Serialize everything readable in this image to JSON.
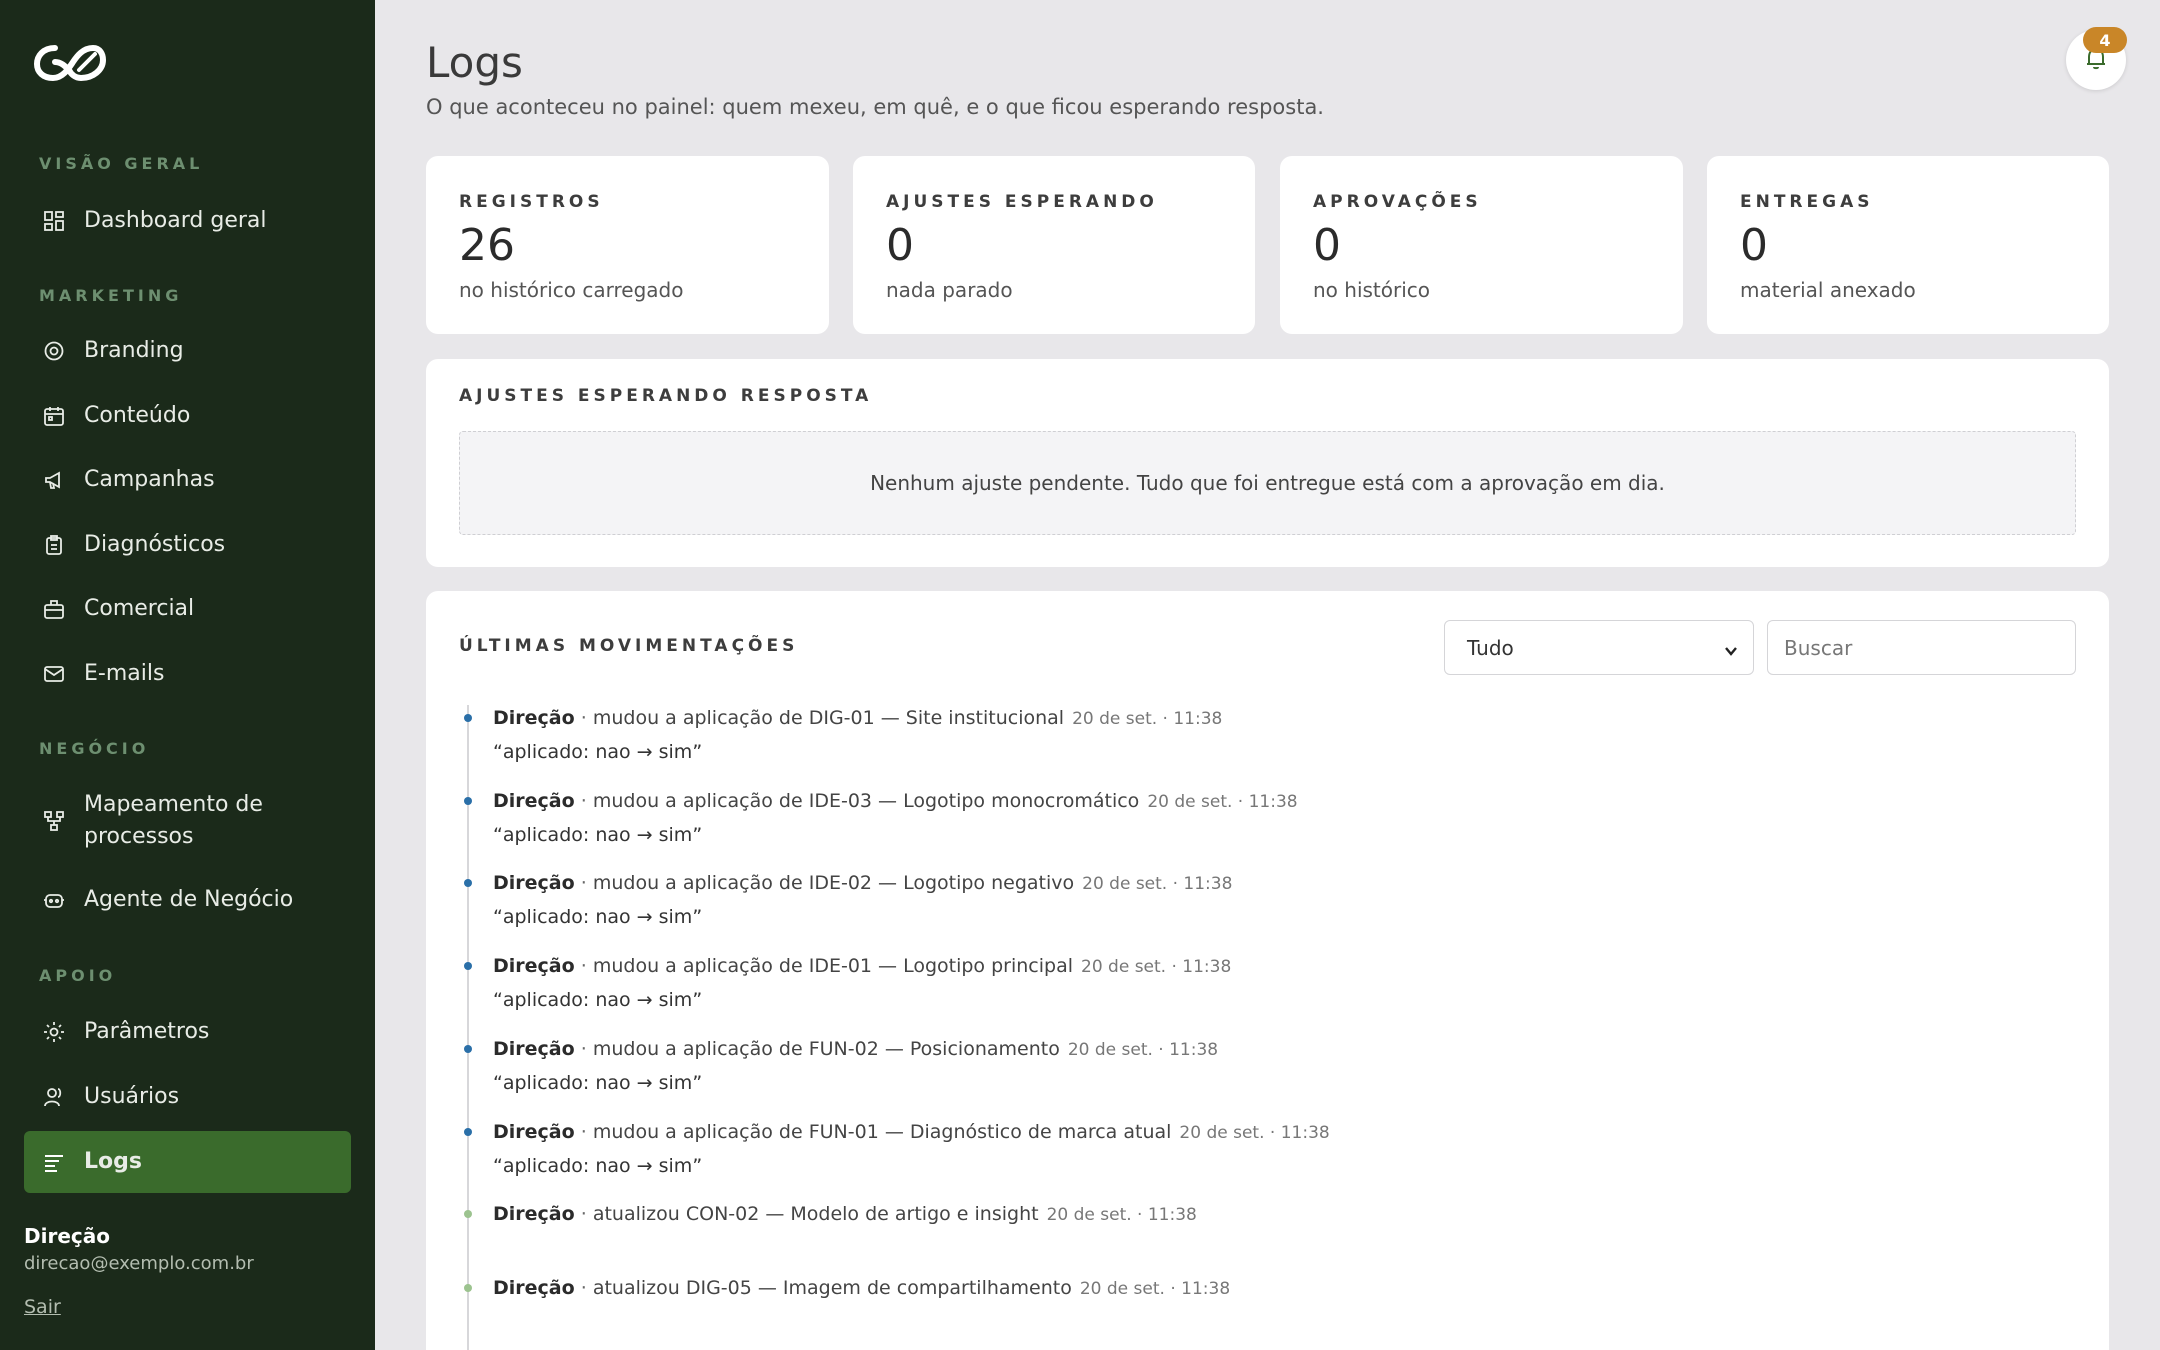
{
  "sidebar": {
    "sections": {
      "overview": "VISÃO GERAL",
      "marketing": "MARKETING",
      "business": "NEGÓCIO",
      "support": "APOIO"
    },
    "items": [
      {
        "label": "Dashboard geral",
        "icon": "dashboard-icon"
      },
      {
        "label": "Branding",
        "icon": "target-icon"
      },
      {
        "label": "Conteúdo",
        "icon": "calendar-icon"
      },
      {
        "label": "Campanhas",
        "icon": "megaphone-icon"
      },
      {
        "label": "Diagnósticos",
        "icon": "clipboard-icon"
      },
      {
        "label": "Comercial",
        "icon": "briefcase-icon"
      },
      {
        "label": "E-mails",
        "icon": "mail-icon"
      },
      {
        "label": "Mapeamento de processos",
        "icon": "flow-icon"
      },
      {
        "label": "Agente de Negócio",
        "icon": "robot-icon"
      },
      {
        "label": "Parâmetros",
        "icon": "gear-icon"
      },
      {
        "label": "Usuários",
        "icon": "users-icon"
      },
      {
        "label": "Logs",
        "icon": "list-icon",
        "active": true
      }
    ],
    "user": {
      "name": "Direção",
      "email": "direcao@exemplo.com.br",
      "logout": "Sair"
    }
  },
  "header": {
    "title": "Logs",
    "subtitle": "O que aconteceu no painel: quem mexeu, em quê, e o que ficou esperando resposta.",
    "notification_count": "4"
  },
  "stats": [
    {
      "label": "REGISTROS",
      "value": "26",
      "sub": "no histórico carregado"
    },
    {
      "label": "AJUSTES ESPERANDO",
      "value": "0",
      "sub": "nada parado"
    },
    {
      "label": "APROVAÇÕES",
      "value": "0",
      "sub": "no histórico"
    },
    {
      "label": "ENTREGAS",
      "value": "0",
      "sub": "material anexado"
    }
  ],
  "pending": {
    "title": "AJUSTES ESPERANDO RESPOSTA",
    "empty_message": "Nenhum ajuste pendente. Tudo que foi entregue está com a aprovação em dia."
  },
  "activity": {
    "title": "ÚLTIMAS MOVIMENTAÇÕES",
    "filter_value": "Tudo",
    "search_placeholder": "Buscar",
    "items": [
      {
        "actor": "Direção",
        "action": "mudou a aplicação de DIG-01 — Site institucional",
        "time": "20 de set. · 11:38",
        "detail": "“aplicado: nao → sim”"
      },
      {
        "actor": "Direção",
        "action": "mudou a aplicação de IDE-03 — Logotipo monocromático",
        "time": "20 de set. · 11:38",
        "detail": "“aplicado: nao → sim”"
      },
      {
        "actor": "Direção",
        "action": "mudou a aplicação de IDE-02 — Logotipo negativo",
        "time": "20 de set. · 11:38",
        "detail": "“aplicado: nao → sim”"
      },
      {
        "actor": "Direção",
        "action": "mudou a aplicação de IDE-01 — Logotipo principal",
        "time": "20 de set. · 11:38",
        "detail": "“aplicado: nao → sim”"
      },
      {
        "actor": "Direção",
        "action": "mudou a aplicação de FUN-02 — Posicionamento",
        "time": "20 de set. · 11:38",
        "detail": "“aplicado: nao → sim”"
      },
      {
        "actor": "Direção",
        "action": "mudou a aplicação de FUN-01 — Diagnóstico de marca atual",
        "time": "20 de set. · 11:38",
        "detail": "“aplicado: nao → sim”"
      },
      {
        "actor": "Direção",
        "action": "atualizou CON-02 — Modelo de artigo e insight",
        "time": "20 de set. · 11:38",
        "detail": ""
      },
      {
        "actor": "Direção",
        "action": "atualizou DIG-05 — Imagem de compartilhamento",
        "time": "20 de set. · 11:38",
        "detail": ""
      }
    ]
  },
  "colors": {
    "sidebar_bg": "#1b2a1a",
    "active_bg": "#3a6b2c",
    "badge": "#c98628",
    "dot_change": "#2a6fa8",
    "dot_update": "#9cc38f"
  }
}
